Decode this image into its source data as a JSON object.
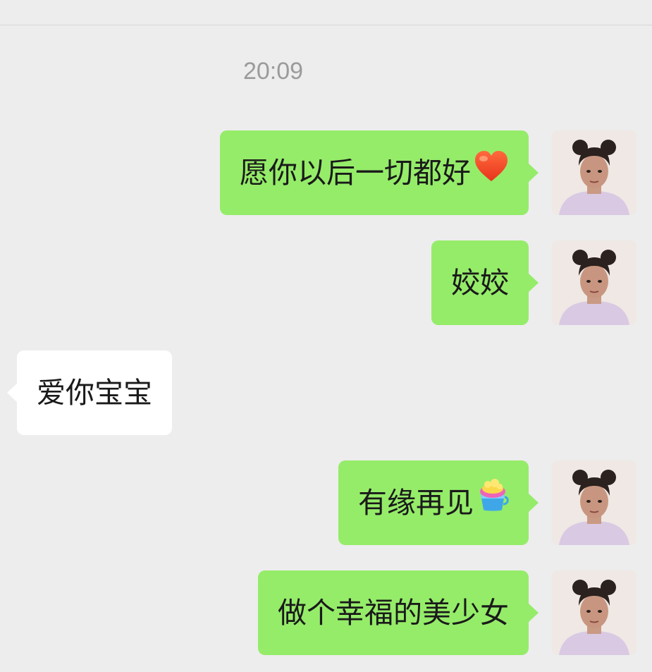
{
  "chat": {
    "timestamp": "20:09",
    "messages": [
      {
        "direction": "out",
        "text": "愿你以后一切都好",
        "emoji": "red-heart"
      },
      {
        "direction": "out",
        "text": "姣姣"
      },
      {
        "direction": "in",
        "text": "爱你宝宝"
      },
      {
        "direction": "out",
        "text": "有缘再见",
        "emoji": "cake-cup"
      },
      {
        "direction": "out",
        "text": "做个幸福的美少女"
      }
    ]
  },
  "colors": {
    "background": "#ededed",
    "outgoing_bubble": "#95ec69",
    "incoming_bubble": "#ffffff",
    "timestamp_text": "#9b9b9b"
  }
}
